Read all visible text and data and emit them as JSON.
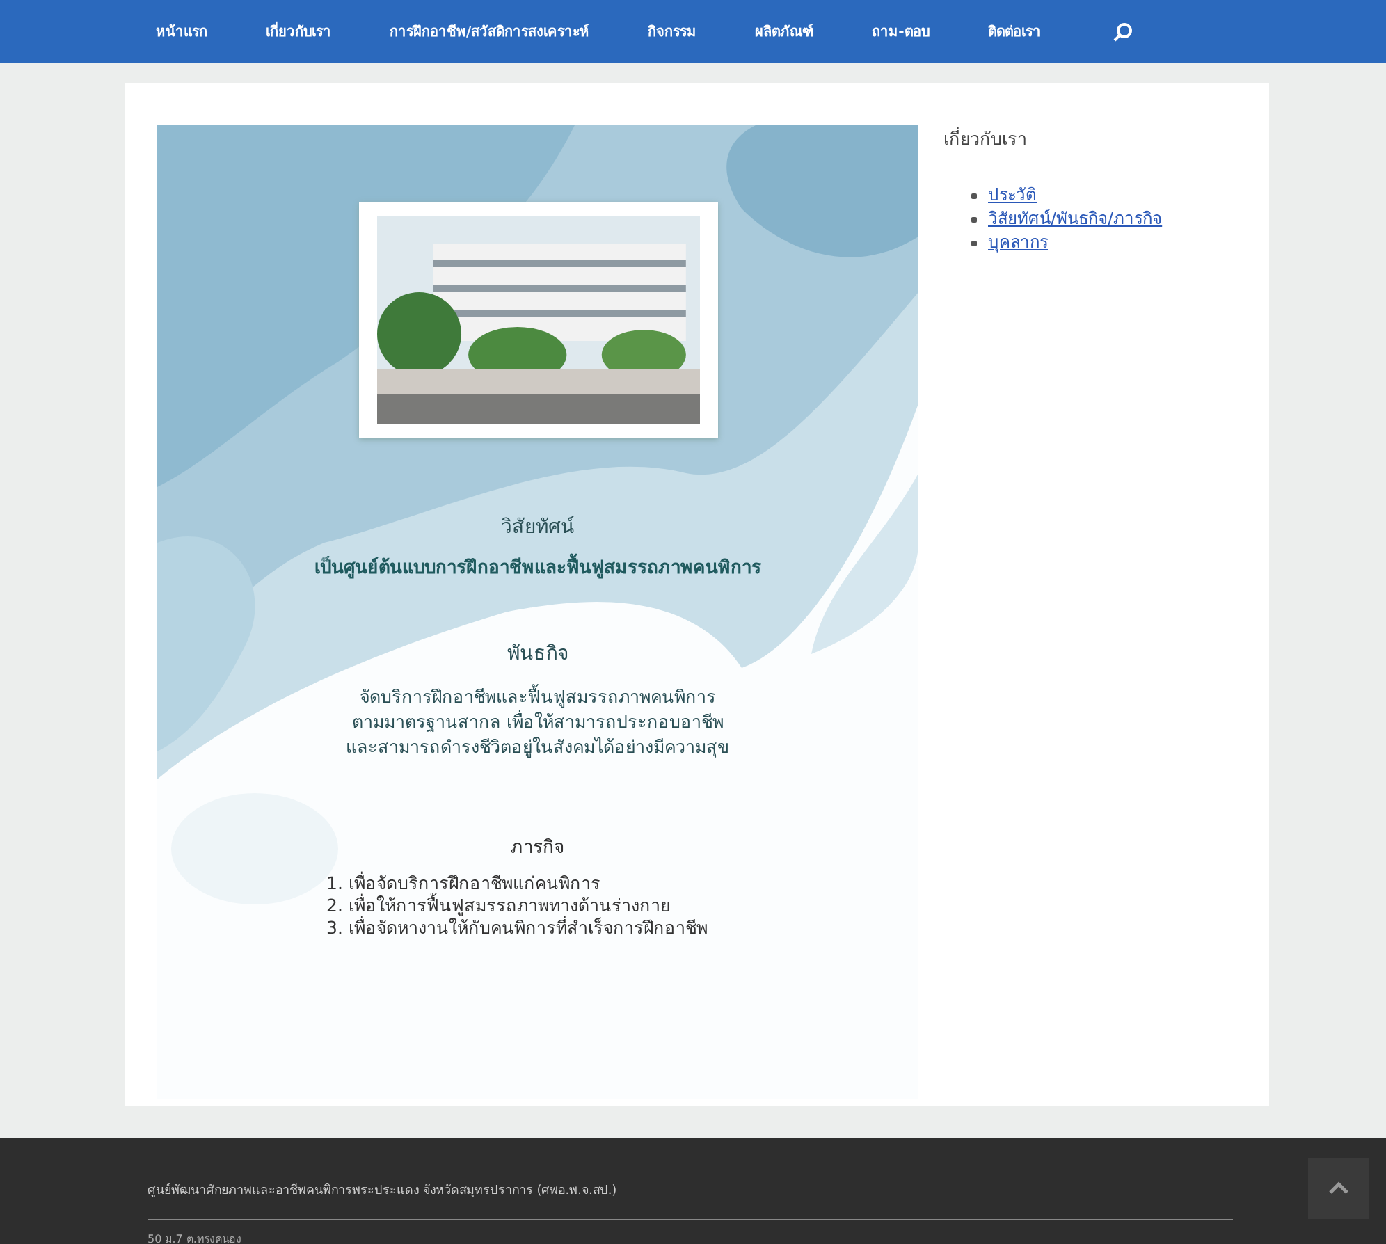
{
  "nav": {
    "items": [
      {
        "label": "หน้าแรก"
      },
      {
        "label": "เกี่ยวกับเรา"
      },
      {
        "label": "การฝึกอาชีพ/สวัสดิการสงเคราะห์"
      },
      {
        "label": "กิจกรรม"
      },
      {
        "label": "ผลิตภัณฑ์"
      },
      {
        "label": "ถาม-ตอบ"
      },
      {
        "label": "ติดต่อเรา"
      }
    ]
  },
  "main": {
    "vision_title": "วิสัยทัศน์",
    "vision": "เป็นศูนย์ต้นแบบการฝึกอาชีพและฟื้นฟูสมรรถภาพคนพิการ",
    "mission_title": "พันธกิจ",
    "mission": [
      "จัดบริการฝึกอาชีพและฟื้นฟูสมรรถภาพคนพิการ",
      "ตามมาตรฐานสากล เพื่อให้สามารถประกอบอาชีพ",
      "และสามารถดำรงชีวิตอยู่ในสังคมได้อย่างมีความสุข"
    ],
    "goals_title": "ภารกิจ",
    "goals": [
      "1. เพื่อจัดบริการฝึกอาชีพแก่คนพิการ",
      "2. เพื่อให้การฟื้นฟูสมรรถภาพทางด้านร่างกาย",
      "3. เพื่อจัดหางานให้กับคนพิการที่สำเร็จการฝึกอาชีพ"
    ]
  },
  "sidebar": {
    "title": "เกี่ยวกับเรา",
    "links": [
      {
        "label": "ประวัติ"
      },
      {
        "label": "วิสัยทัศน์/พันธกิจ/ภารกิจ"
      },
      {
        "label": "บุคลากร"
      }
    ]
  },
  "footer": {
    "name": "ศูนย์พัฒนาศักยภาพและอาชีพคนพิการพระประแดง จังหวัดสมุทรปราการ (ศพอ.พ.จ.สป.)",
    "address": "50 ม.7 ต.ทรงคนอง"
  }
}
